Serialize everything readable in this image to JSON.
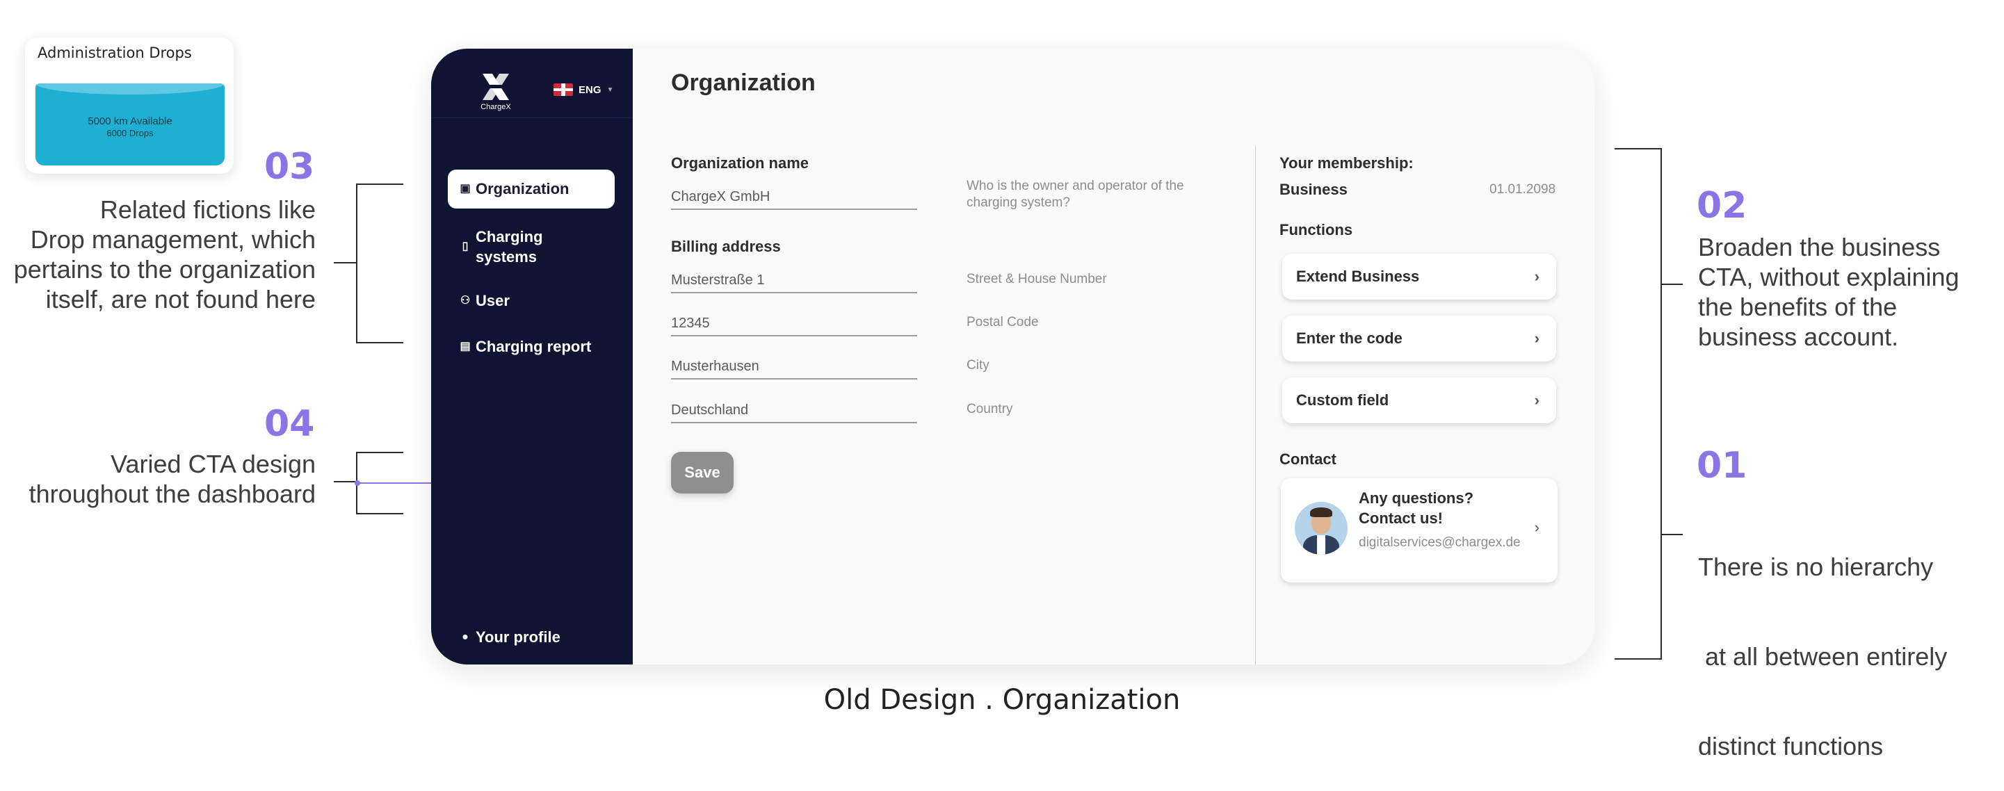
{
  "drops_widget": {
    "title": "Administration Drops",
    "available": "5000 km Available",
    "drops": "6000 Drops",
    "fill_fraction": 0.8
  },
  "annotations": {
    "a03": {
      "num": "03",
      "lines": [
        "Related fictions like",
        "Drop management, which",
        "pertains to the organization",
        "itself, are not found here"
      ]
    },
    "a04": {
      "num": "04",
      "lines": [
        "Varied CTA design",
        "throughout the dashboard"
      ]
    },
    "a02": {
      "num": "02",
      "lines": [
        "Broaden the business",
        "CTA, without explaining",
        "the benefits of the",
        "business account."
      ]
    },
    "a01": {
      "num": "01",
      "lines": [
        "There is no hierarchy",
        " at all between entirely",
        "distinct functions"
      ]
    }
  },
  "sidebar": {
    "logo_text": "ChargeX",
    "language": "ENG",
    "items": [
      {
        "label": "Organization",
        "icon": "briefcase-icon",
        "active": true
      },
      {
        "label": "Charging systems",
        "icon": "charger-icon",
        "active": false
      },
      {
        "label": "User",
        "icon": "users-icon",
        "active": false
      },
      {
        "label": "Charging report",
        "icon": "document-icon",
        "active": false
      }
    ],
    "profile_label": "Your profile"
  },
  "main": {
    "title": "Organization",
    "org_name_label": "Organization name",
    "org_name_value": "ChargeX GmbH",
    "org_hint": "Who is the owner and operator of the charging system?",
    "billing_label": "Billing address",
    "fields": [
      {
        "value": "Musterstraße 1",
        "hint": "Street & House Number"
      },
      {
        "value": "12345",
        "hint": "Postal Code"
      },
      {
        "value": "Musterhausen",
        "hint": "City"
      },
      {
        "value": "Deutschland",
        "hint": "Country"
      }
    ],
    "save_label": "Save"
  },
  "membership": {
    "heading": "Your membership:",
    "plan": "Business",
    "date": "01.01.2098",
    "functions_label": "Functions",
    "functions": [
      "Extend Business",
      "Enter the code",
      "Custom field"
    ],
    "contact_label": "Contact",
    "contact_title": "Any questions? Contact us!",
    "contact_email": "digitalservices@chargex.de"
  },
  "colors": {
    "accent": "#8b74e6",
    "sidebar": "#0f1432",
    "drops": "#1fafd2"
  },
  "caption": "Old Design . Organization"
}
